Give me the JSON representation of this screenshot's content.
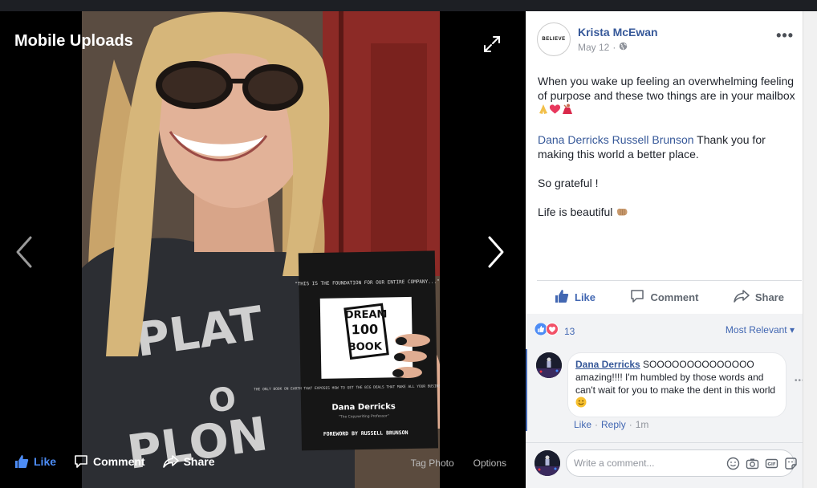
{
  "viewer": {
    "album_title": "Mobile Uploads",
    "actions": {
      "like": "Like",
      "comment": "Comment",
      "share": "Share"
    },
    "tag_photo": "Tag Photo",
    "options": "Options",
    "book": {
      "quote": "\"THIS IS THE FOUNDATION FOR OUR ENTIRE COMPANY...\"",
      "logo_line1": "DREAM",
      "logo_line2": "100",
      "logo_line3": "BOOK",
      "tagline": "THE ONLY BOOK ON EARTH THAT EXPOSES HOW TO GET THE BIG DEALS THAT MAKE ALL YOUR BUSINESS DREAMS COME TRUE!",
      "author": "Dana Derricks",
      "author_sub": "\"The Copywriting Professor\"",
      "foreword": "FOREWORD BY RUSSELL BRUNSON"
    },
    "shirt_text": "PLAT O PLON"
  },
  "post": {
    "author": "Krista McEwan",
    "avatar_text": "BELIEVE",
    "date": "May 12",
    "more": "•••",
    "paragraph1": "When you wake up feeling an overwhelming feeling of purpose and these two things are in your mailbox",
    "mention1": "Dana Derricks",
    "mention2": "Russell Brunson",
    "paragraph2_rest": " Thank you for making this world a better place.",
    "paragraph3": "So grateful !",
    "paragraph4": "Life is beautiful",
    "actions": {
      "like": "Like",
      "comment": "Comment",
      "share": "Share"
    }
  },
  "reactions": {
    "count": "13",
    "sort_label": "Most Relevant"
  },
  "comment": {
    "author": "Dana Derricks",
    "text": " SOOOOOOOOOOOOOO amazing!!!! I'm humbled by those words and can't wait for you to make the dent in this world",
    "like": "Like",
    "reply": "Reply",
    "time": "1m",
    "sep": "·"
  },
  "composer": {
    "placeholder": "Write a comment..."
  },
  "colors": {
    "fb_blue": "#4267b2",
    "link": "#365899",
    "muted": "#90949c"
  }
}
